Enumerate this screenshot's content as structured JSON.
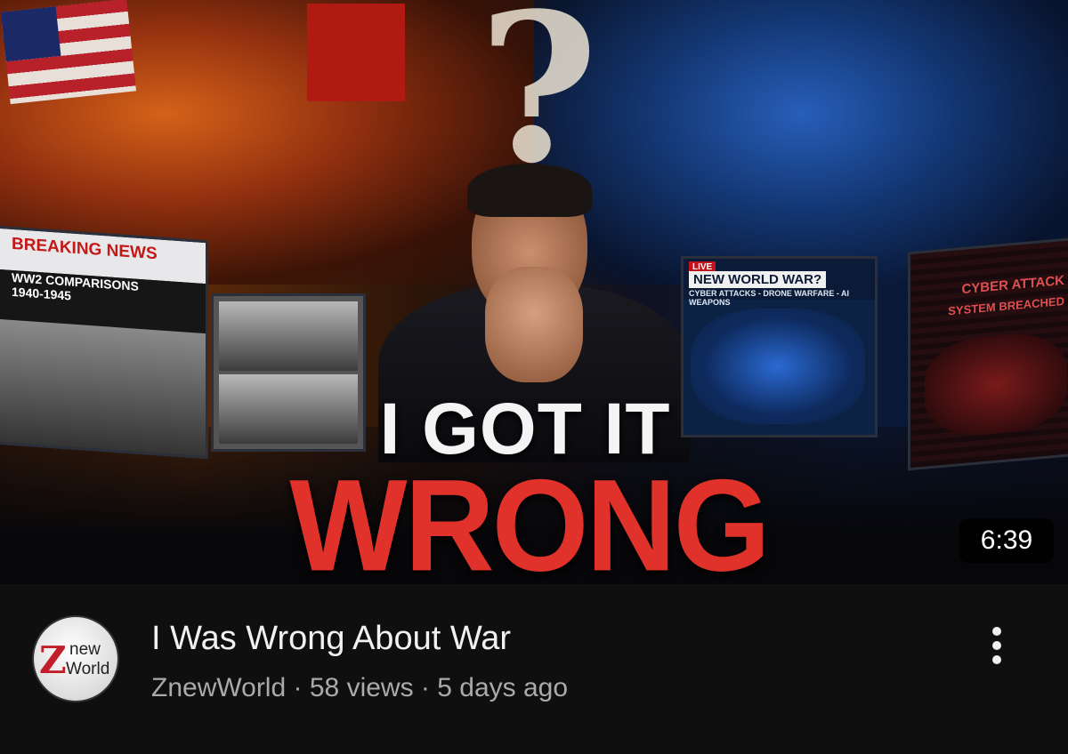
{
  "thumbnail": {
    "duration": "6:39",
    "overlay_line1": "I GOT IT",
    "overlay_line2": "WRONG",
    "screen_left": {
      "banner": "BREAKING NEWS",
      "sub1": "WW2 COMPARISONS",
      "sub2": "1940-1945"
    },
    "screen_right": {
      "live": "LIVE",
      "title": "NEW WORLD WAR?",
      "sub": "CYBER ATTACKS - DRONE WARFARE - AI WEAPONS"
    },
    "screen_cyber": {
      "line1": "CYBER ATTACK",
      "line2": "SYSTEM BREACHED"
    }
  },
  "video": {
    "title": "I Was Wrong About War",
    "channel": "ZnewWorld",
    "separator": "·",
    "views": "58 views",
    "age": "5 days ago"
  },
  "avatar": {
    "logo_z": "Z",
    "logo_new": "new",
    "logo_world": "World"
  },
  "colors": {
    "background": "#0f0f0f",
    "title": "#f1f1f1",
    "meta": "#aaaaaa",
    "accent_red": "#e0322a"
  },
  "icons": {
    "menu": "more-vertical-icon"
  }
}
